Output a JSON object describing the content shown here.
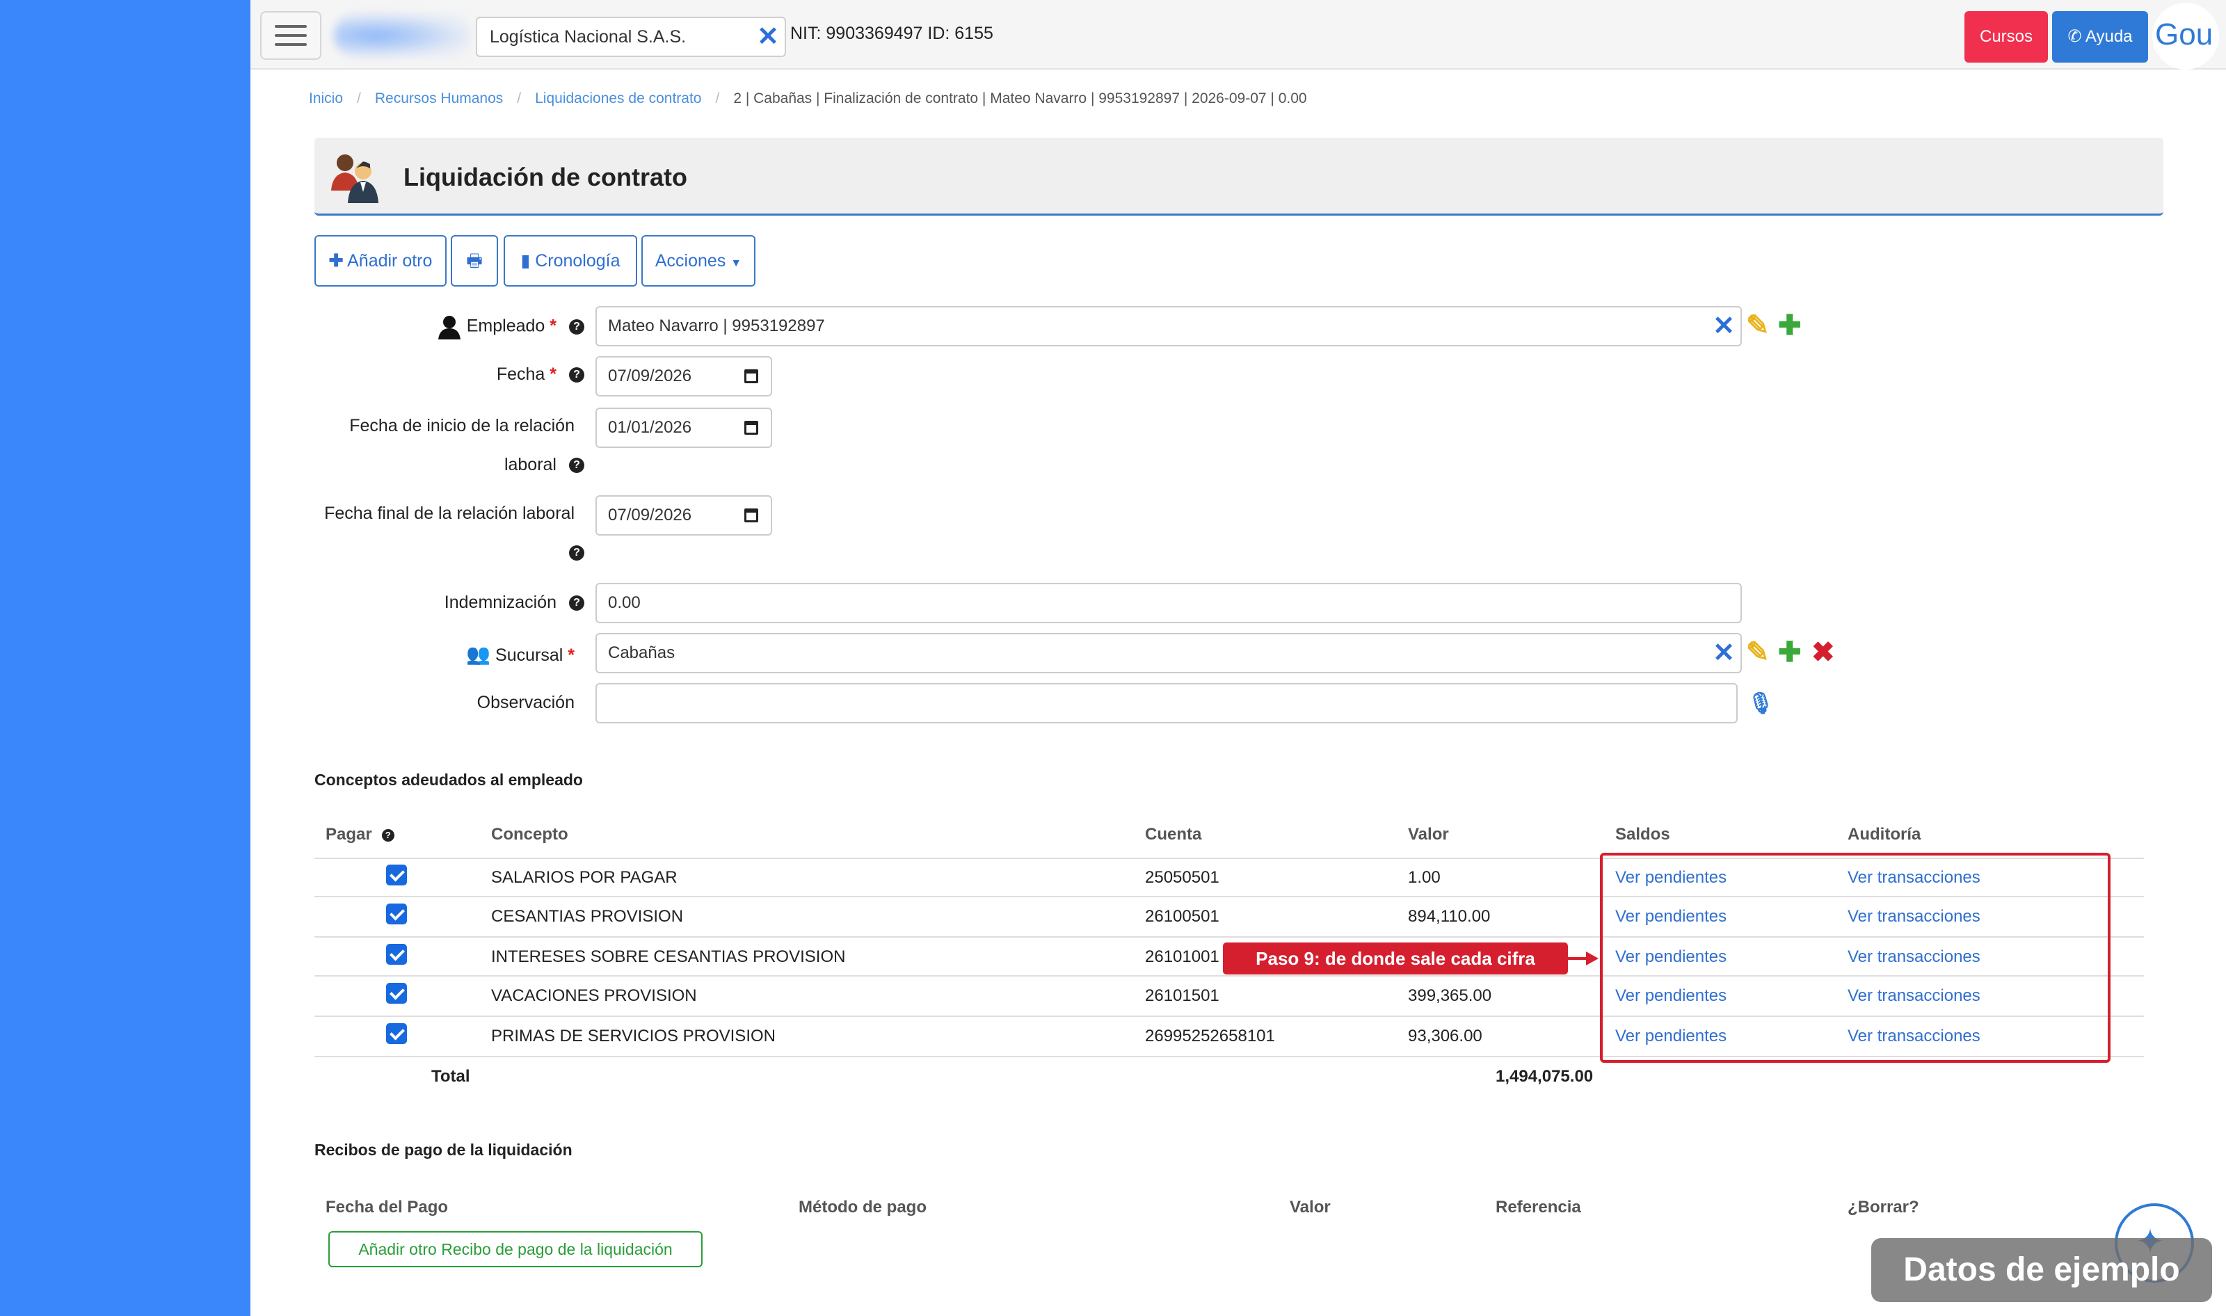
{
  "topbar": {
    "company": "Logística Nacional S.A.S.",
    "nit_info": "NIT: 9903369497 ID: 6155",
    "cursos_label": "Cursos",
    "ayuda_label": "Ayuda",
    "avatar_text": "Gou"
  },
  "breadcrumb": {
    "items": [
      "Inicio",
      "Recursos Humanos",
      "Liquidaciones de contrato"
    ],
    "current": "2 | Cabañas | Finalización de contrato | Mateo Navarro | 9953192897 | 2026-09-07 | 0.00"
  },
  "page": {
    "title": "Liquidación de contrato"
  },
  "toolbar": {
    "add_label": "Añadir otro",
    "timeline_label": "Cronología",
    "actions_label": "Acciones"
  },
  "form": {
    "employee": {
      "label": "Empleado",
      "value": "Mateo Navarro | 9953192897"
    },
    "date": {
      "label": "Fecha",
      "value": "07/09/2026"
    },
    "start_date": {
      "label_line1": "Fecha de inicio de la relación",
      "label_line2": "laboral",
      "value": "01/01/2026"
    },
    "end_date": {
      "label_line1": "Fecha final de la relación laboral",
      "value": "07/09/2026"
    },
    "indemnity": {
      "label": "Indemnización",
      "value": "0.00"
    },
    "branch": {
      "label": "Sucursal",
      "value": "Cabañas"
    },
    "observation": {
      "label": "Observación",
      "value": ""
    }
  },
  "concepts": {
    "title": "Conceptos adeudados al empleado",
    "headers": {
      "pay": "Pagar",
      "concept": "Concepto",
      "account": "Cuenta",
      "value": "Valor",
      "balances": "Saldos",
      "audit": "Auditoría"
    },
    "rows": [
      {
        "checked": true,
        "concept": "SALARIOS POR PAGAR",
        "account": "25050501",
        "value": "1.00",
        "balances": "Ver pendientes",
        "audit": "Ver transacciones"
      },
      {
        "checked": true,
        "concept": "CESANTIAS PROVISION",
        "account": "26100501",
        "value": "894,110.00",
        "balances": "Ver pendientes",
        "audit": "Ver transacciones"
      },
      {
        "checked": true,
        "concept": "INTERESES SOBRE CESANTIAS PROVISION",
        "account": "26101001",
        "value": "",
        "balances": "Ver pendientes",
        "audit": "Ver transacciones"
      },
      {
        "checked": true,
        "concept": "VACACIONES PROVISION",
        "account": "26101501",
        "value": "399,365.00",
        "balances": "Ver pendientes",
        "audit": "Ver transacciones"
      },
      {
        "checked": true,
        "concept": "PRIMAS DE SERVICIOS PROVISION",
        "account": "26995252658101",
        "value": "93,306.00",
        "balances": "Ver pendientes",
        "audit": "Ver transacciones"
      }
    ],
    "total_label": "Total",
    "total_value": "1,494,075.00",
    "callout": "Paso 9: de donde sale cada cifra"
  },
  "receipts": {
    "title": "Recibos de pago de la liquidación",
    "headers": {
      "date": "Fecha del Pago",
      "method": "Método de pago",
      "value": "Valor",
      "reference": "Referencia",
      "delete": "¿Borrar?"
    },
    "add_label": "Añadir otro Recibo de pago de la liquidación"
  },
  "watermark": "Datos de ejemplo",
  "colors": {
    "sidebar": "#3a86fb",
    "accent": "#2f6fcf",
    "danger": "#f0304e",
    "highlight": "#d61f2e",
    "success": "#2a9d3a"
  }
}
